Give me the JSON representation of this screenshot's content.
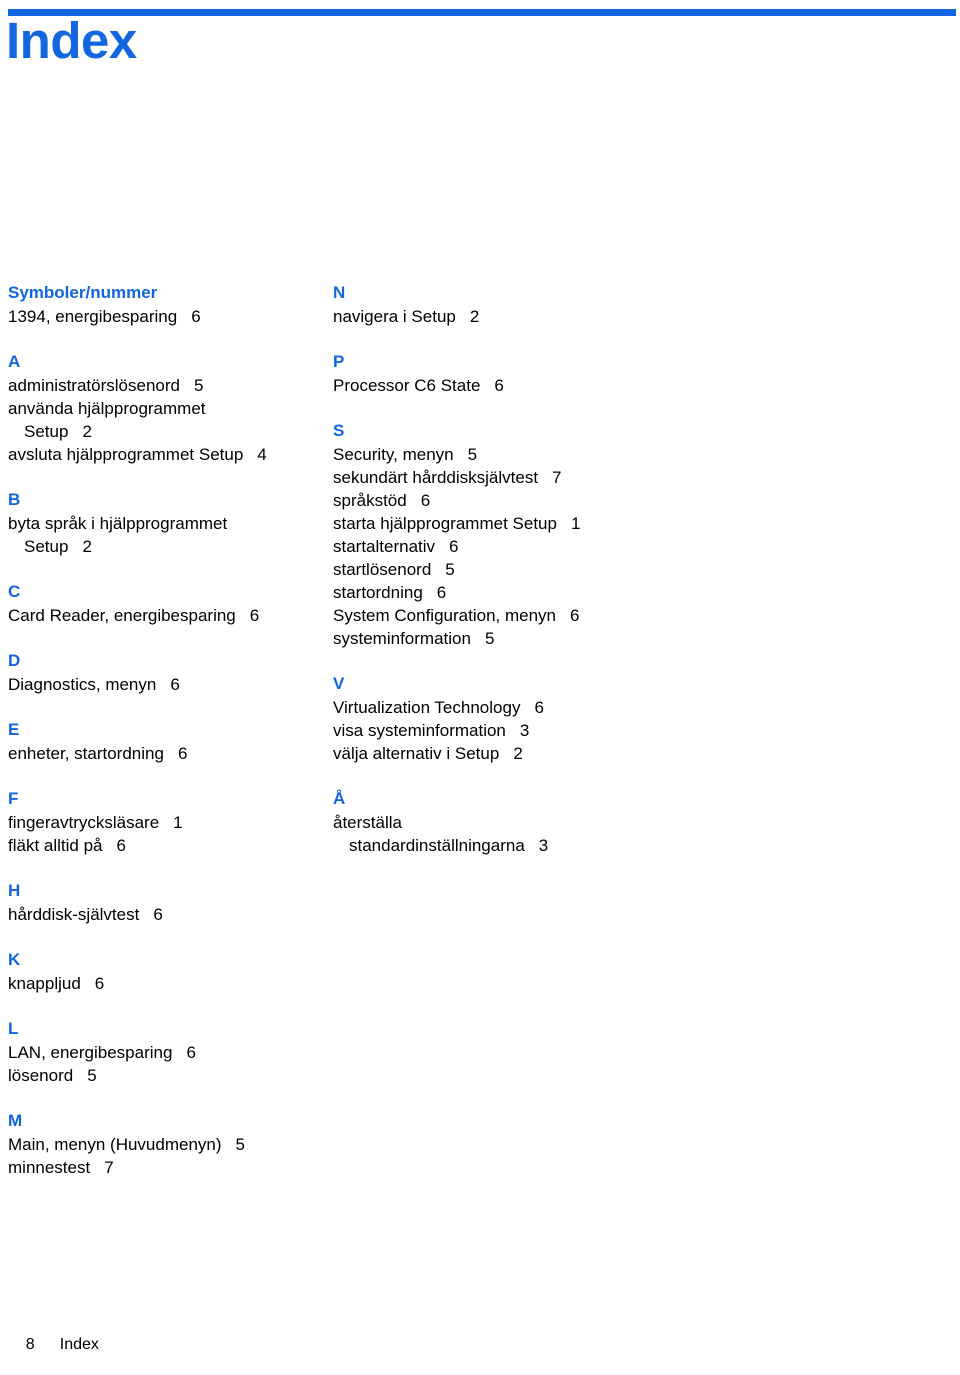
{
  "header": {
    "title": "Index",
    "rule_color": "#1266E0",
    "title_color": "#1266E0"
  },
  "footer": {
    "page_number": "8",
    "label": "Index"
  },
  "columns": {
    "left": [
      {
        "letter": "Symboler/nummer",
        "entries": [
          {
            "text": "1394, energibesparing",
            "page": "6",
            "sub": false
          }
        ]
      },
      {
        "letter": "A",
        "entries": [
          {
            "text": "administratörslösenord",
            "page": "5",
            "sub": false
          },
          {
            "text": "använda hjälpprogrammet",
            "page": "",
            "sub": false
          },
          {
            "text": "Setup",
            "page": "2",
            "sub": true
          },
          {
            "text": "avsluta hjälpprogrammet Setup",
            "page": "4",
            "sub": false
          }
        ]
      },
      {
        "letter": "B",
        "entries": [
          {
            "text": "byta språk i hjälpprogrammet",
            "page": "",
            "sub": false
          },
          {
            "text": "Setup",
            "page": "2",
            "sub": true
          }
        ]
      },
      {
        "letter": "C",
        "entries": [
          {
            "text": "Card Reader, energibesparing",
            "page": "6",
            "sub": false
          }
        ]
      },
      {
        "letter": "D",
        "entries": [
          {
            "text": "Diagnostics, menyn",
            "page": "6",
            "sub": false
          }
        ]
      },
      {
        "letter": "E",
        "entries": [
          {
            "text": "enheter, startordning",
            "page": "6",
            "sub": false
          }
        ]
      },
      {
        "letter": "F",
        "entries": [
          {
            "text": "fingeravtrycksläsare",
            "page": "1",
            "sub": false
          },
          {
            "text": "fläkt alltid på",
            "page": "6",
            "sub": false
          }
        ]
      },
      {
        "letter": "H",
        "entries": [
          {
            "text": "hårddisk-självtest",
            "page": "6",
            "sub": false
          }
        ]
      },
      {
        "letter": "K",
        "entries": [
          {
            "text": "knappljud",
            "page": "6",
            "sub": false
          }
        ]
      },
      {
        "letter": "L",
        "entries": [
          {
            "text": "LAN, energibesparing",
            "page": "6",
            "sub": false
          },
          {
            "text": "lösenord",
            "page": "5",
            "sub": false
          }
        ]
      },
      {
        "letter": "M",
        "entries": [
          {
            "text": "Main, menyn (Huvudmenyn)",
            "page": "5",
            "sub": false
          },
          {
            "text": "minnestest",
            "page": "7",
            "sub": false
          }
        ]
      }
    ],
    "right": [
      {
        "letter": "N",
        "entries": [
          {
            "text": "navigera i Setup",
            "page": "2",
            "sub": false
          }
        ]
      },
      {
        "letter": "P",
        "entries": [
          {
            "text": "Processor C6 State",
            "page": "6",
            "sub": false
          }
        ]
      },
      {
        "letter": "S",
        "entries": [
          {
            "text": "Security, menyn",
            "page": "5",
            "sub": false
          },
          {
            "text": "sekundärt hårddisksjälvtest",
            "page": "7",
            "sub": false
          },
          {
            "text": "språkstöd",
            "page": "6",
            "sub": false
          },
          {
            "text": "starta hjälpprogrammet Setup",
            "page": "1",
            "sub": false
          },
          {
            "text": "startalternativ",
            "page": "6",
            "sub": false
          },
          {
            "text": "startlösenord",
            "page": "5",
            "sub": false
          },
          {
            "text": "startordning",
            "page": "6",
            "sub": false
          },
          {
            "text": "System Configuration, menyn",
            "page": "6",
            "sub": false
          },
          {
            "text": "systeminformation",
            "page": "5",
            "sub": false
          }
        ]
      },
      {
        "letter": "V",
        "entries": [
          {
            "text": "Virtualization Technology",
            "page": "6",
            "sub": false
          },
          {
            "text": "visa systeminformation",
            "page": "3",
            "sub": false
          },
          {
            "text": "välja alternativ i Setup",
            "page": "2",
            "sub": false
          }
        ]
      },
      {
        "letter": "Å",
        "entries": [
          {
            "text": "återställa",
            "page": "",
            "sub": false
          },
          {
            "text": "standardinställningarna",
            "page": "3",
            "sub": true
          }
        ]
      }
    ]
  }
}
